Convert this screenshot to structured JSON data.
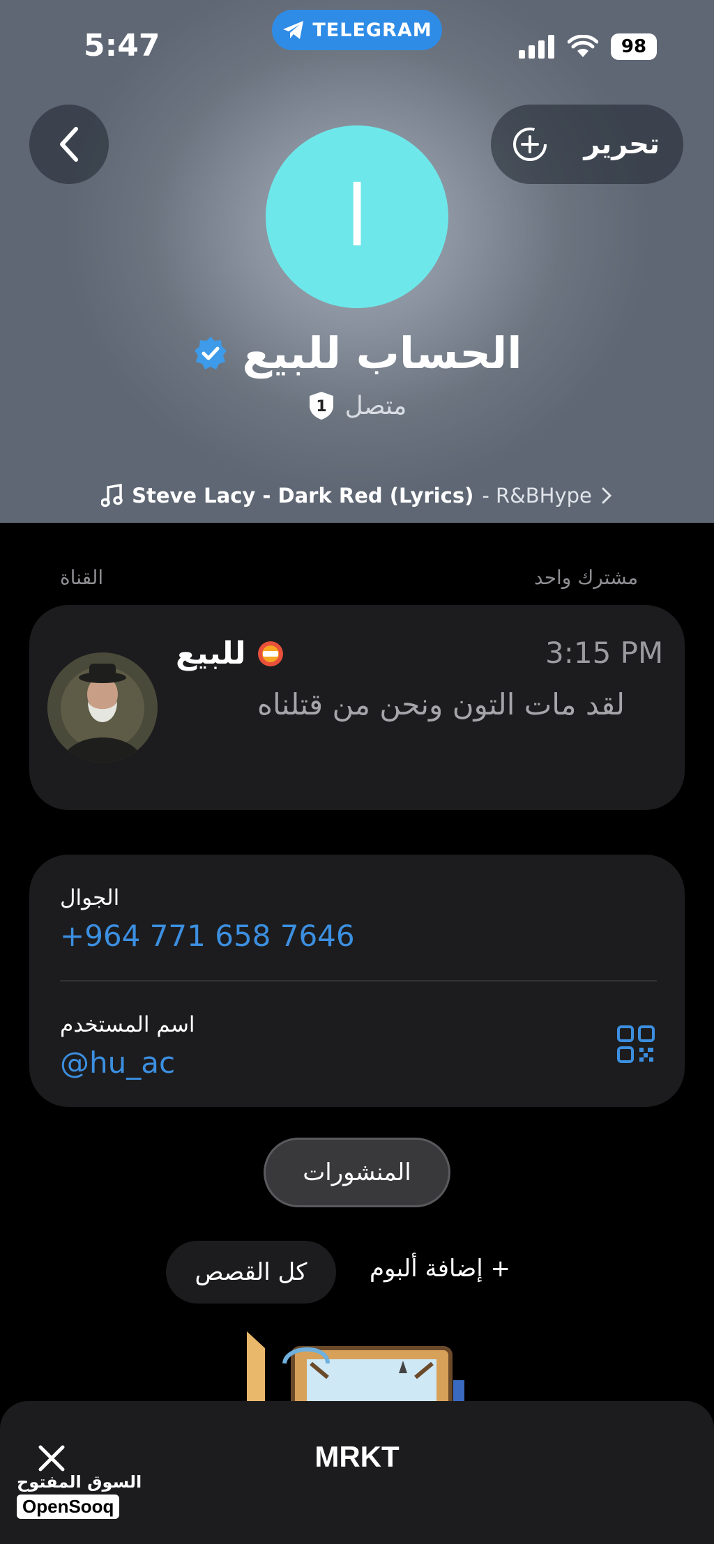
{
  "status_bar": {
    "time": "5:47",
    "app_badge": "TELEGRAM",
    "battery": "98"
  },
  "header": {
    "edit_label": "تحرير",
    "avatar_letter": "ا",
    "profile_name": "الحساب للبيع",
    "status_text": "متصل",
    "status_badge_count": "1",
    "music_title": "Steve Lacy - Dark Red (Lyrics)",
    "music_artist": "- R&BHype"
  },
  "sections": {
    "subscribers": "مشترك واحد",
    "channel": "القناة"
  },
  "channel_card": {
    "name": "للبيع",
    "time": "3:15 PM",
    "message": "لقد مات التون ونحن من قتلناه"
  },
  "contact_card": {
    "phone_label": "الجوال",
    "phone_value": "+964 771 658 7646",
    "username_label": "اسم المستخدم",
    "username_value": "@hu_ac"
  },
  "posts_button": "المنشورات",
  "stories": {
    "all_stories": "كل القصص",
    "add_album": "+ إضافة ألبوم"
  },
  "bottom_sheet": {
    "title": "MRKT"
  },
  "watermark": {
    "arabic": "السوق المفتوح",
    "english": "OpenSooq"
  },
  "colors": {
    "accent_blue": "#3c8fe0",
    "telegram_blue": "#2f8ce6",
    "avatar_cyan": "#6ee7ea",
    "card_bg": "#1c1c1e"
  }
}
